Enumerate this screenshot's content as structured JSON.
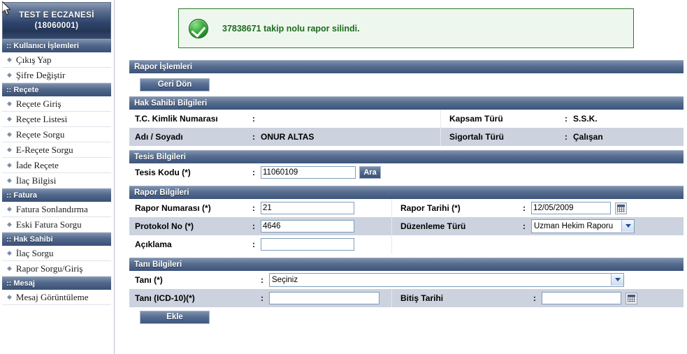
{
  "sidebar": {
    "brand_line1": "TEST E ECZANESİ",
    "brand_line2": "(18060001)",
    "groups": [
      {
        "title": ":: Kullanıcı İşlemleri",
        "items": [
          {
            "label": "Çıkış Yap"
          },
          {
            "label": "Şifre Değiştir"
          }
        ]
      },
      {
        "title": ":: Reçete",
        "items": [
          {
            "label": "Reçete Giriş"
          },
          {
            "label": "Reçete Listesi"
          },
          {
            "label": "Reçete Sorgu"
          },
          {
            "label": "E-Reçete Sorgu"
          },
          {
            "label": "İade Reçete"
          },
          {
            "label": "İlaç Bilgisi"
          }
        ]
      },
      {
        "title": ":: Fatura",
        "items": [
          {
            "label": "Fatura Sonlandırma"
          },
          {
            "label": "Eski Fatura Sorgu"
          }
        ]
      },
      {
        "title": ":: Hak Sahibi",
        "items": [
          {
            "label": "İlaç Sorgu"
          },
          {
            "label": "Rapor Sorgu/Giriş"
          }
        ]
      },
      {
        "title": ":: Mesaj",
        "items": [
          {
            "label": "Mesaj Görüntüleme"
          }
        ]
      }
    ]
  },
  "notification": {
    "icon": "success-check-icon",
    "text": "37838671 takip nolu rapor silindi.",
    "border_color": "#2d7a2d",
    "background_color": "#eef7ee",
    "text_color": "#1f6b1f"
  },
  "panel": {
    "title": "Rapor İşlemleri",
    "back_button": "Geri Dön"
  },
  "beneficiary": {
    "title": "Hak Sahibi Bilgileri",
    "tc_label": "T.C. Kimlik Numarası",
    "tc_value": "",
    "name_label": "Adı / Soyadı",
    "name_value": "ONUR ALTAS",
    "scope_label": "Kapsam Türü",
    "scope_value": "S.S.K.",
    "insured_label": "Sigortalı Türü",
    "insured_value": "Çalışan",
    "colon": ":"
  },
  "facility": {
    "title": "Tesis Bilgileri",
    "code_label": "Tesis Kodu (*)",
    "code_value": "11060109",
    "search_button": "Ara",
    "colon": ":"
  },
  "report": {
    "title": "Rapor Bilgileri",
    "number_label": "Rapor Numarası (*)",
    "number_value": "21",
    "date_label": "Rapor Tarihi (*)",
    "date_value": "12/05/2009",
    "protocol_label": "Protokol No (*)",
    "protocol_value": "4646",
    "type_label": "Düzenleme Türü",
    "type_value": "Uzman Hekim Raporu",
    "type_options": [
      "Uzman Hekim Raporu"
    ],
    "description_label": "Açıklama",
    "description_value": "",
    "colon": ":",
    "calendar_icon": "calendar-icon"
  },
  "diagnosis": {
    "title": "Tanı Bilgileri",
    "tani_label": "Tanı (*)",
    "tani_value": "Seçiniz",
    "tani_options": [
      "Seçiniz"
    ],
    "icd_label": "Tanı (ICD-10)(*)",
    "icd_value": "",
    "end_date_label": "Bitiş Tarihi",
    "end_date_value": "",
    "add_button": "Ekle",
    "colon": ":",
    "calendar_icon": "calendar-icon"
  },
  "cursor": {
    "icon": "mouse-pointer-icon"
  }
}
